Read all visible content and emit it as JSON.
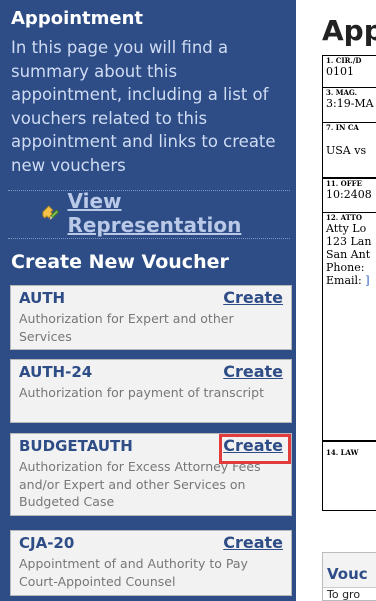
{
  "sidebar": {
    "title": "Appointment",
    "description": "In this page you will find a summary about this appointment, including a list of vouchers related to this appointment and links to create new vouchers",
    "view_representation": "View Representation",
    "create_new_voucher_title": "Create New Voucher",
    "vouchers": [
      {
        "name": "AUTH",
        "create_label": "Create",
        "description": "Authorization for Expert and other Services"
      },
      {
        "name": "AUTH-24",
        "create_label": "Create",
        "description": "Authorization for payment of transcript"
      },
      {
        "name": "BUDGETAUTH",
        "create_label": "Create",
        "description": "Authorization for Excess Attorney Fees and/or Expert and other Services on Budgeted Case"
      },
      {
        "name": "CJA-20",
        "create_label": "Create",
        "description": "Appointment of and Authority to Pay Court-Appointed Counsel"
      }
    ]
  },
  "main": {
    "title": "App",
    "form": {
      "cir_label": "1. CIR./D",
      "cir_value": "0101",
      "mag_label": "3. MAG.",
      "mag_value": "3:19-MA",
      "in_case_label": "7. IN CA",
      "in_case_value": "USA vs",
      "offense_label": "11. OFFE",
      "offense_value": "10:2408",
      "attorney_label": "12. ATTO",
      "attorney_lines": [
        "Atty Lo",
        "123 Lan",
        "San Ant",
        "Phone:"
      ],
      "attorney_email_label": "Email:",
      "attorney_email_value": "]",
      "law_label": "14. LAW"
    },
    "vouchers_panel_title": "Vouc",
    "vouchers_panel_subtitle": "To gro"
  },
  "colors": {
    "sidebar_bg": "#2e4d87",
    "card_bg": "#f2f2f2",
    "highlight": "#e13b3b"
  },
  "icons": {
    "view_representation": "puzzle-pencil-icon"
  }
}
